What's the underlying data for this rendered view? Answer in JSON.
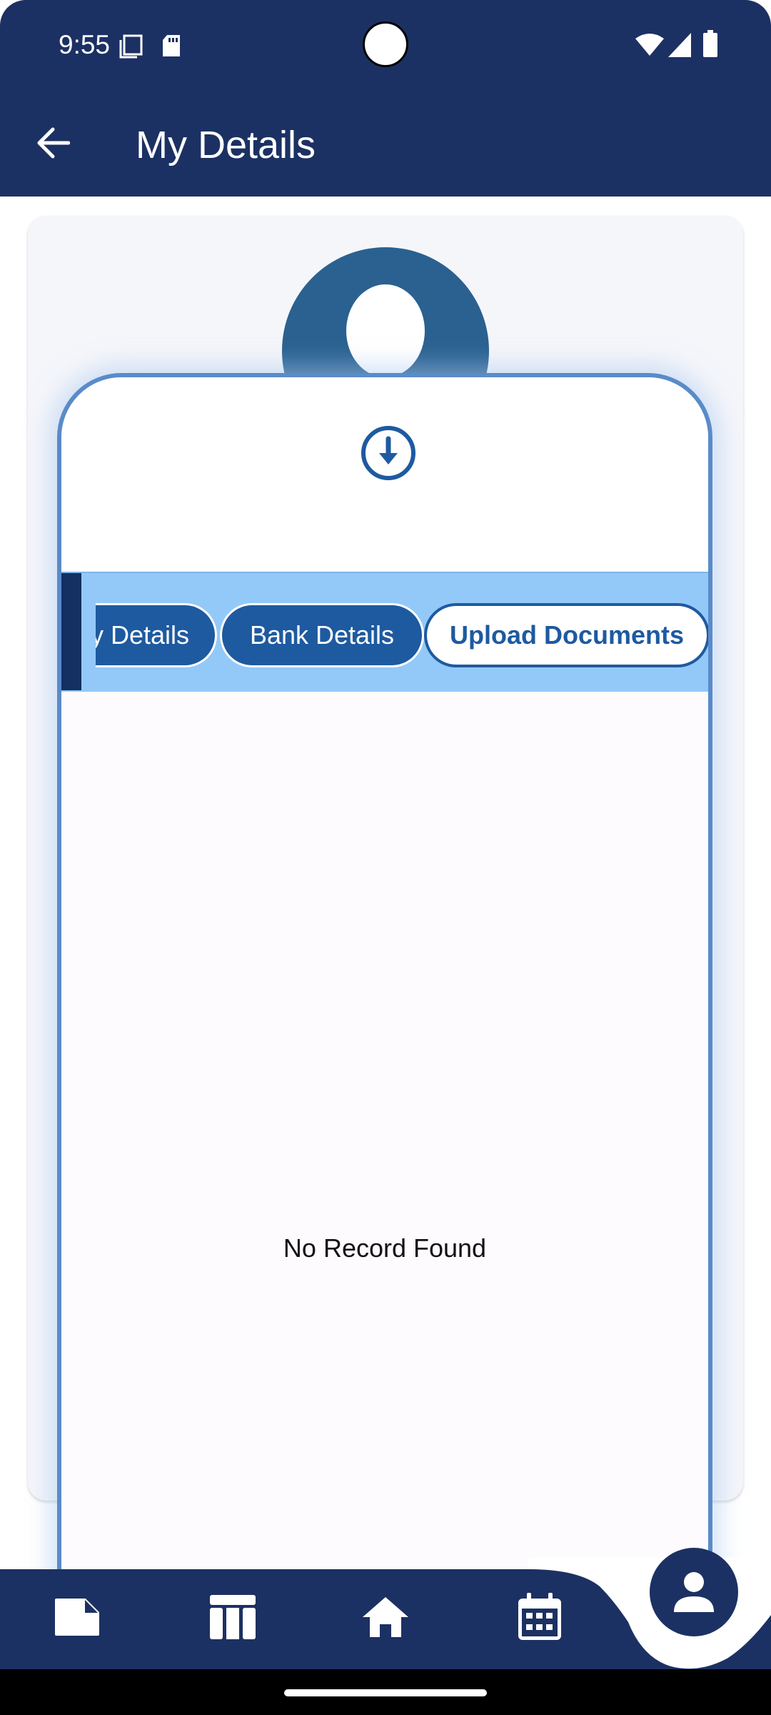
{
  "status_bar": {
    "time": "9:55",
    "left_icons": [
      "screen-icon",
      "sd-card-icon"
    ],
    "right_icons": [
      "wifi-icon",
      "signal-icon",
      "battery-icon"
    ]
  },
  "app_bar": {
    "back_icon": "arrow-left-icon",
    "title": "My Details"
  },
  "profile": {
    "avatar_icon": "user-avatar-icon",
    "download_icon": "download-circle-icon"
  },
  "tabs": [
    {
      "label": "y Details",
      "active": false
    },
    {
      "label": "Bank Details",
      "active": false
    },
    {
      "label": "Upload Documents",
      "active": true
    }
  ],
  "content": {
    "empty_message": "No Record Found"
  },
  "bottom_nav": {
    "items": [
      {
        "icon": "note-icon"
      },
      {
        "icon": "table-icon"
      },
      {
        "icon": "home-icon"
      },
      {
        "icon": "calendar-icon"
      },
      {
        "icon": "person-icon",
        "active": true
      }
    ]
  },
  "colors": {
    "primary_dark": "#1c3163",
    "tab_strip": "#93c9f8",
    "tab_blue": "#1e5aa0",
    "avatar_blue": "#2a6190",
    "panel_border": "#5a8bc9"
  }
}
